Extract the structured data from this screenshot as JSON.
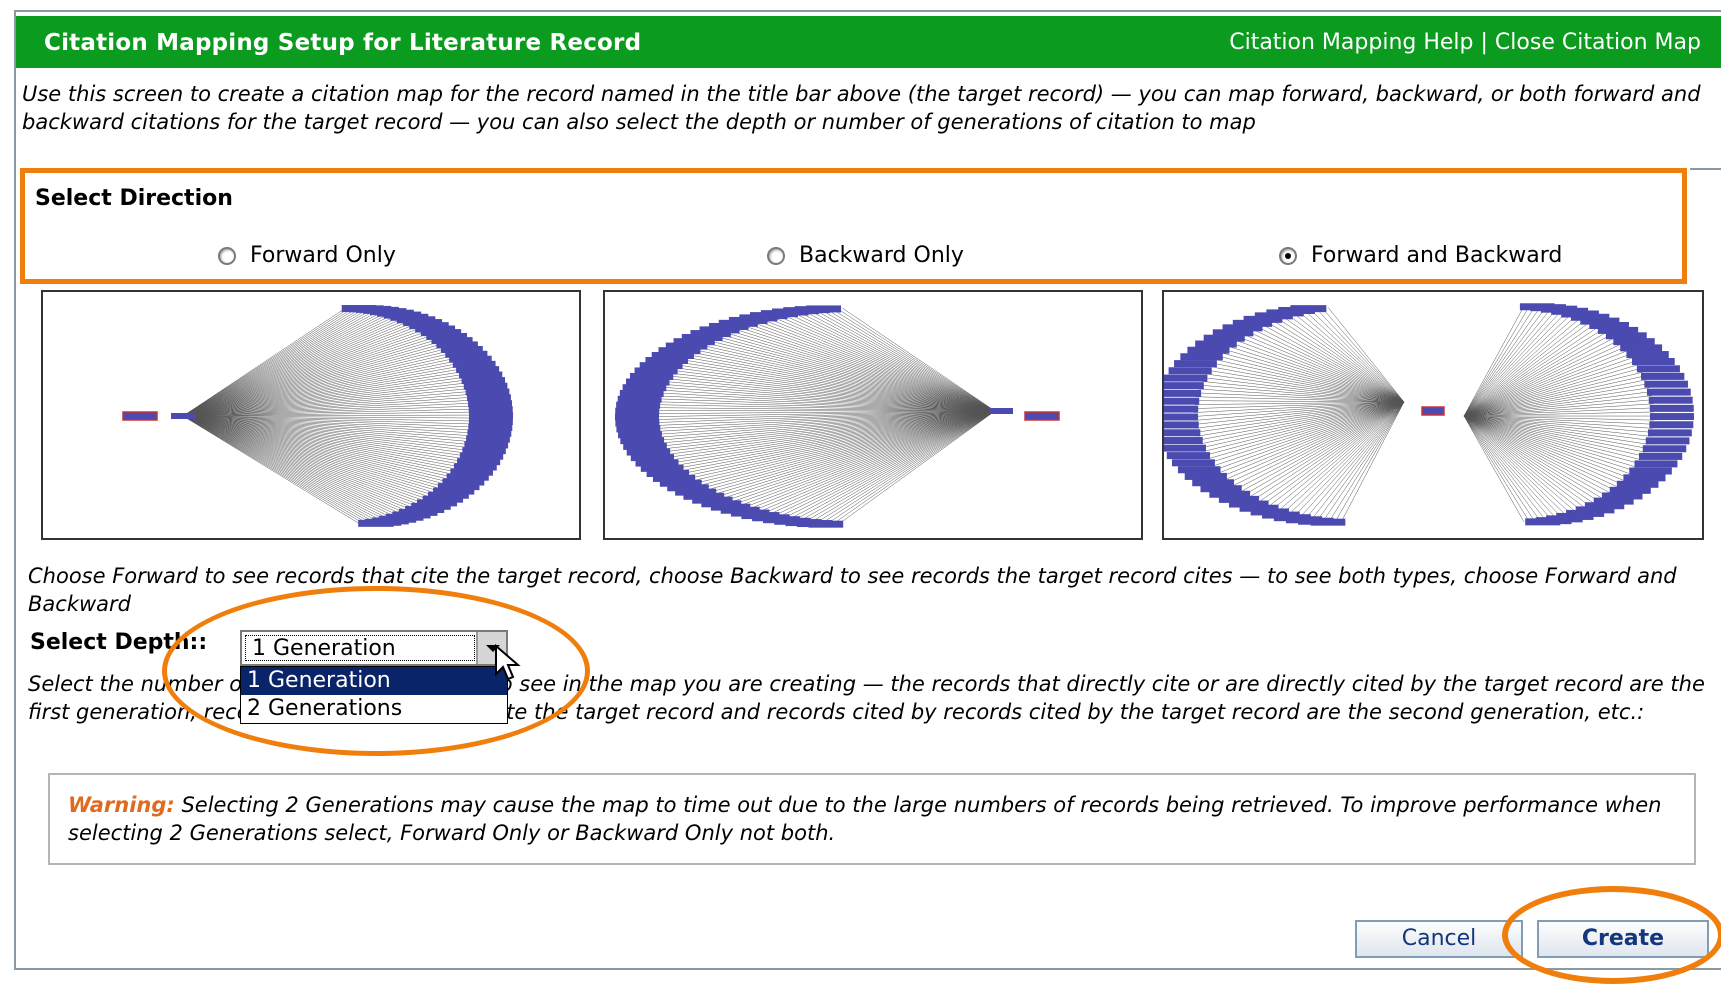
{
  "titlebar": {
    "title": "Citation Mapping Setup for Literature Record",
    "help_link": "Citation Mapping Help",
    "separator": "|",
    "close_link": "Close Citation Map"
  },
  "intro_text": "Use this screen to create a citation map for the record named in the title bar above (the target record) — you can map forward, backward, or both forward and backward citations for the target record — you can also select the depth or number of generations of citation to map",
  "direction": {
    "title": "Select Direction",
    "options": [
      {
        "label": "Forward Only",
        "checked": false
      },
      {
        "label": "Backward Only",
        "checked": false
      },
      {
        "label": "Forward and Backward",
        "checked": true
      }
    ]
  },
  "choose_text": "Choose Forward to see records that cite the target record, choose Backward to see records the target record cites — to see both types, choose Forward and Backward",
  "depth": {
    "label": "Select Depth::",
    "selected": "1 Generation",
    "options": [
      "1 Generation",
      "2 Generations"
    ],
    "description": "Select the number of generations you want to see in the map you are creating — the records that directly cite or are directly cited by the target record are the first generation, records citing records that cite the target record and records cited by records cited by the target record are the second generation, etc.:"
  },
  "warning": {
    "label": "Warning:",
    "text": " Selecting 2 Generations may cause the map to time out due to the large numbers of records being retrieved. To improve performance when selecting 2 Generations select, Forward Only or Backward Only not both."
  },
  "buttons": {
    "cancel": "Cancel",
    "create": "Create"
  },
  "colors": {
    "titlebar": "#0a9b1f",
    "highlight": "#f07e0c",
    "node_blue": "#4a4ab0",
    "warning_label": "#e06a20"
  }
}
